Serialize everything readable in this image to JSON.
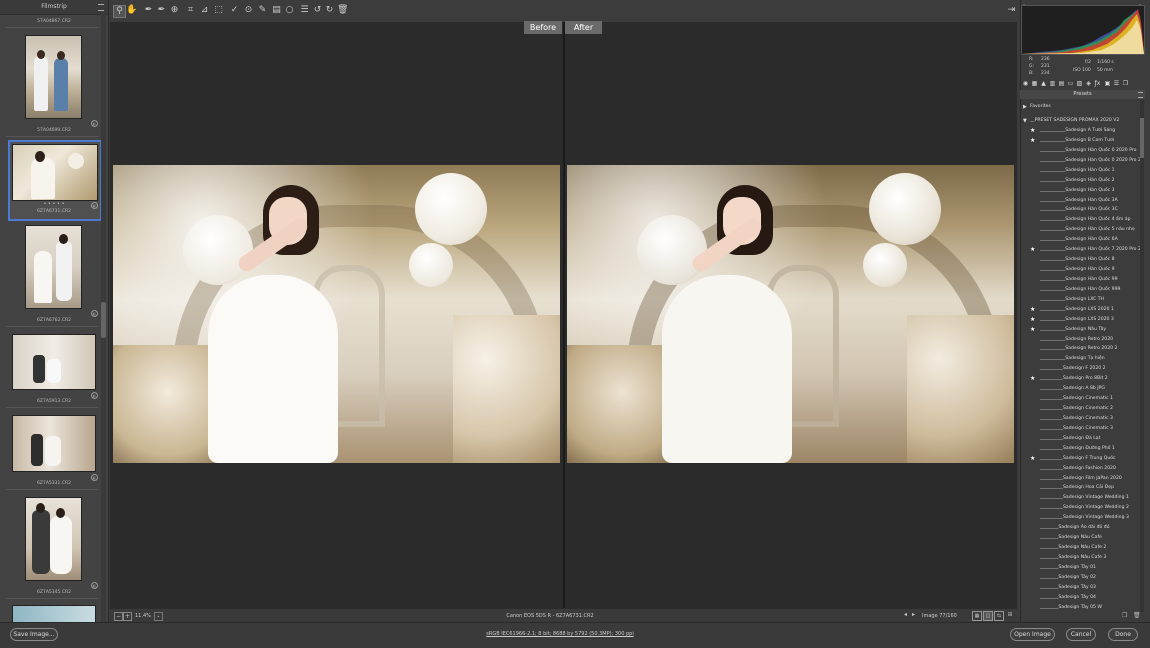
{
  "filmstrip": {
    "title": "Filmstrip",
    "items": [
      {
        "name_above": "57A04867.CR2",
        "name": "57A04699.CR2"
      },
      {
        "name": "6Z7A6731.CR2",
        "rating": "• • • • •"
      },
      {
        "name": "6Z7A6762.CR2"
      },
      {
        "name": "6Z7A5913.CR2"
      },
      {
        "name": "6Z7A5331.CR2"
      },
      {
        "name": "6Z7A5345.CR2"
      }
    ]
  },
  "compare": {
    "before": "Before",
    "after": "After"
  },
  "status": {
    "zoom": "11.4%",
    "camera": "Canon EOS 5DS R  -  6Z7A6731.CR2",
    "image_count": "Image 77/160"
  },
  "info": {
    "r_label": "R:",
    "r_val": "236",
    "g_label": "G:",
    "g_val": "231",
    "b_label": "B:",
    "b_val": "234",
    "aperture": "f/2",
    "shutter": "1/160 s",
    "iso": "ISO 100",
    "focal": "50 mm"
  },
  "presets": {
    "header": "Presets",
    "favorites": "Favorites",
    "group": "__PRESET SADESIGN PROMAX 2020 V2",
    "items": [
      {
        "label": "___________Sadesign A Tươi Sáng",
        "star": true
      },
      {
        "label": "___________Sadesign B  Cam Tươi",
        "star": true
      },
      {
        "label": "___________Sadesign Hàn Quốc 0 2020 Pro",
        "star": false
      },
      {
        "label": "___________Sadesign Hàn Quốc 0 2020 Pro 2",
        "star": false
      },
      {
        "label": "___________Sadesign Hàn Quốc 1",
        "star": false
      },
      {
        "label": "___________Sadesign Hàn Quốc 2",
        "star": false
      },
      {
        "label": "___________Sadesign Hàn Quốc 3",
        "star": false
      },
      {
        "label": "___________Sadesign Hàn Quốc 3A",
        "star": false
      },
      {
        "label": "___________Sadesign Hàn Quốc 3C",
        "star": false
      },
      {
        "label": "___________Sadesign Hàn Quốc 4 ấm áp",
        "star": false
      },
      {
        "label": "___________Sadesign Hàn Quốc 5 nâu nhẹ",
        "star": false
      },
      {
        "label": "___________Sadesign Hàn Quốc 6A",
        "star": false
      },
      {
        "label": "___________Sadesign Hàn Quốc 7 2020 Pro 2",
        "star": true
      },
      {
        "label": "___________Sadesign Hàn Quốc 8",
        "star": false
      },
      {
        "label": "___________Sadesign Hàn Quốc 9",
        "star": false
      },
      {
        "label": "___________Sadesign Hàn Quốc 99",
        "star": false
      },
      {
        "label": "___________Sadesign Hàn Quốc 999",
        "star": false
      },
      {
        "label": "___________Sadesign LXC  TH",
        "star": false
      },
      {
        "label": "___________Sadesign LXS 2020 1",
        "star": true
      },
      {
        "label": "___________Sadesign LXS 2020 3",
        "star": true
      },
      {
        "label": "___________Sadesign Nâu Tây",
        "star": true
      },
      {
        "label": "___________Sadesign Retro 2020",
        "star": false
      },
      {
        "label": "___________Sadesign Retro 2020 2",
        "star": false
      },
      {
        "label": "___________Sadesign Tạ hiện",
        "star": false
      },
      {
        "label": "__________Sadesign  F 2020 2",
        "star": false
      },
      {
        "label": "__________Sadesign  Pro 8Bit 2",
        "star": true
      },
      {
        "label": "__________Sadesign  A 8b JPG",
        "star": false
      },
      {
        "label": "__________Sadesign Cinematic 1",
        "star": false
      },
      {
        "label": "__________Sadesign Cinematic 2",
        "star": false
      },
      {
        "label": "__________Sadesign Cinematic 3",
        "star": false
      },
      {
        "label": "__________Sadesign Cinematic 3",
        "star": false
      },
      {
        "label": "__________Sadesign Đà Lạt",
        "star": false
      },
      {
        "label": "__________Sadesign Đường Phố 1",
        "star": false
      },
      {
        "label": "__________Sadesign F Trung Quốc",
        "star": true
      },
      {
        "label": "__________Sadesign Fashion 2020",
        "star": false
      },
      {
        "label": "__________Sadesign Film JaPan 2020",
        "star": false
      },
      {
        "label": "__________Sadesign Hoa Cải Đẹp",
        "star": false
      },
      {
        "label": "__________Sadesign Vintage Wedding 1",
        "star": false
      },
      {
        "label": "__________Sadesign Vintage Wedding 2",
        "star": false
      },
      {
        "label": "__________Sadesign Vintage Wedding 3",
        "star": false
      },
      {
        "label": "________Sadesign Áo dài đỏ đỏ",
        "star": false
      },
      {
        "label": "________Sadesign Nâu Cafe",
        "star": false
      },
      {
        "label": "________Sadesign Nâu Cafe 2",
        "star": false
      },
      {
        "label": "________Sadesign Nâu Cafe 3",
        "star": false
      },
      {
        "label": "________Sadesign Tây 01",
        "star": false
      },
      {
        "label": "________Sadesign Tây 02",
        "star": false
      },
      {
        "label": "________Sadesign Tây 03",
        "star": false
      },
      {
        "label": "________Sadesign Tây 04",
        "star": false
      },
      {
        "label": "________Sadesign Tây 05 W",
        "star": false
      }
    ]
  },
  "footer": {
    "save": "Save Image...",
    "workflow": "sRGB IEC61966-2.1; 8 bit; 8688 by 5792 (50.3MP); 300 ppi",
    "open": "Open Image",
    "cancel": "Cancel",
    "done": "Done"
  },
  "colors": {
    "accent": "#4a7bd0",
    "panel": "#3c3c3c",
    "preview": "#2b2b2b"
  }
}
